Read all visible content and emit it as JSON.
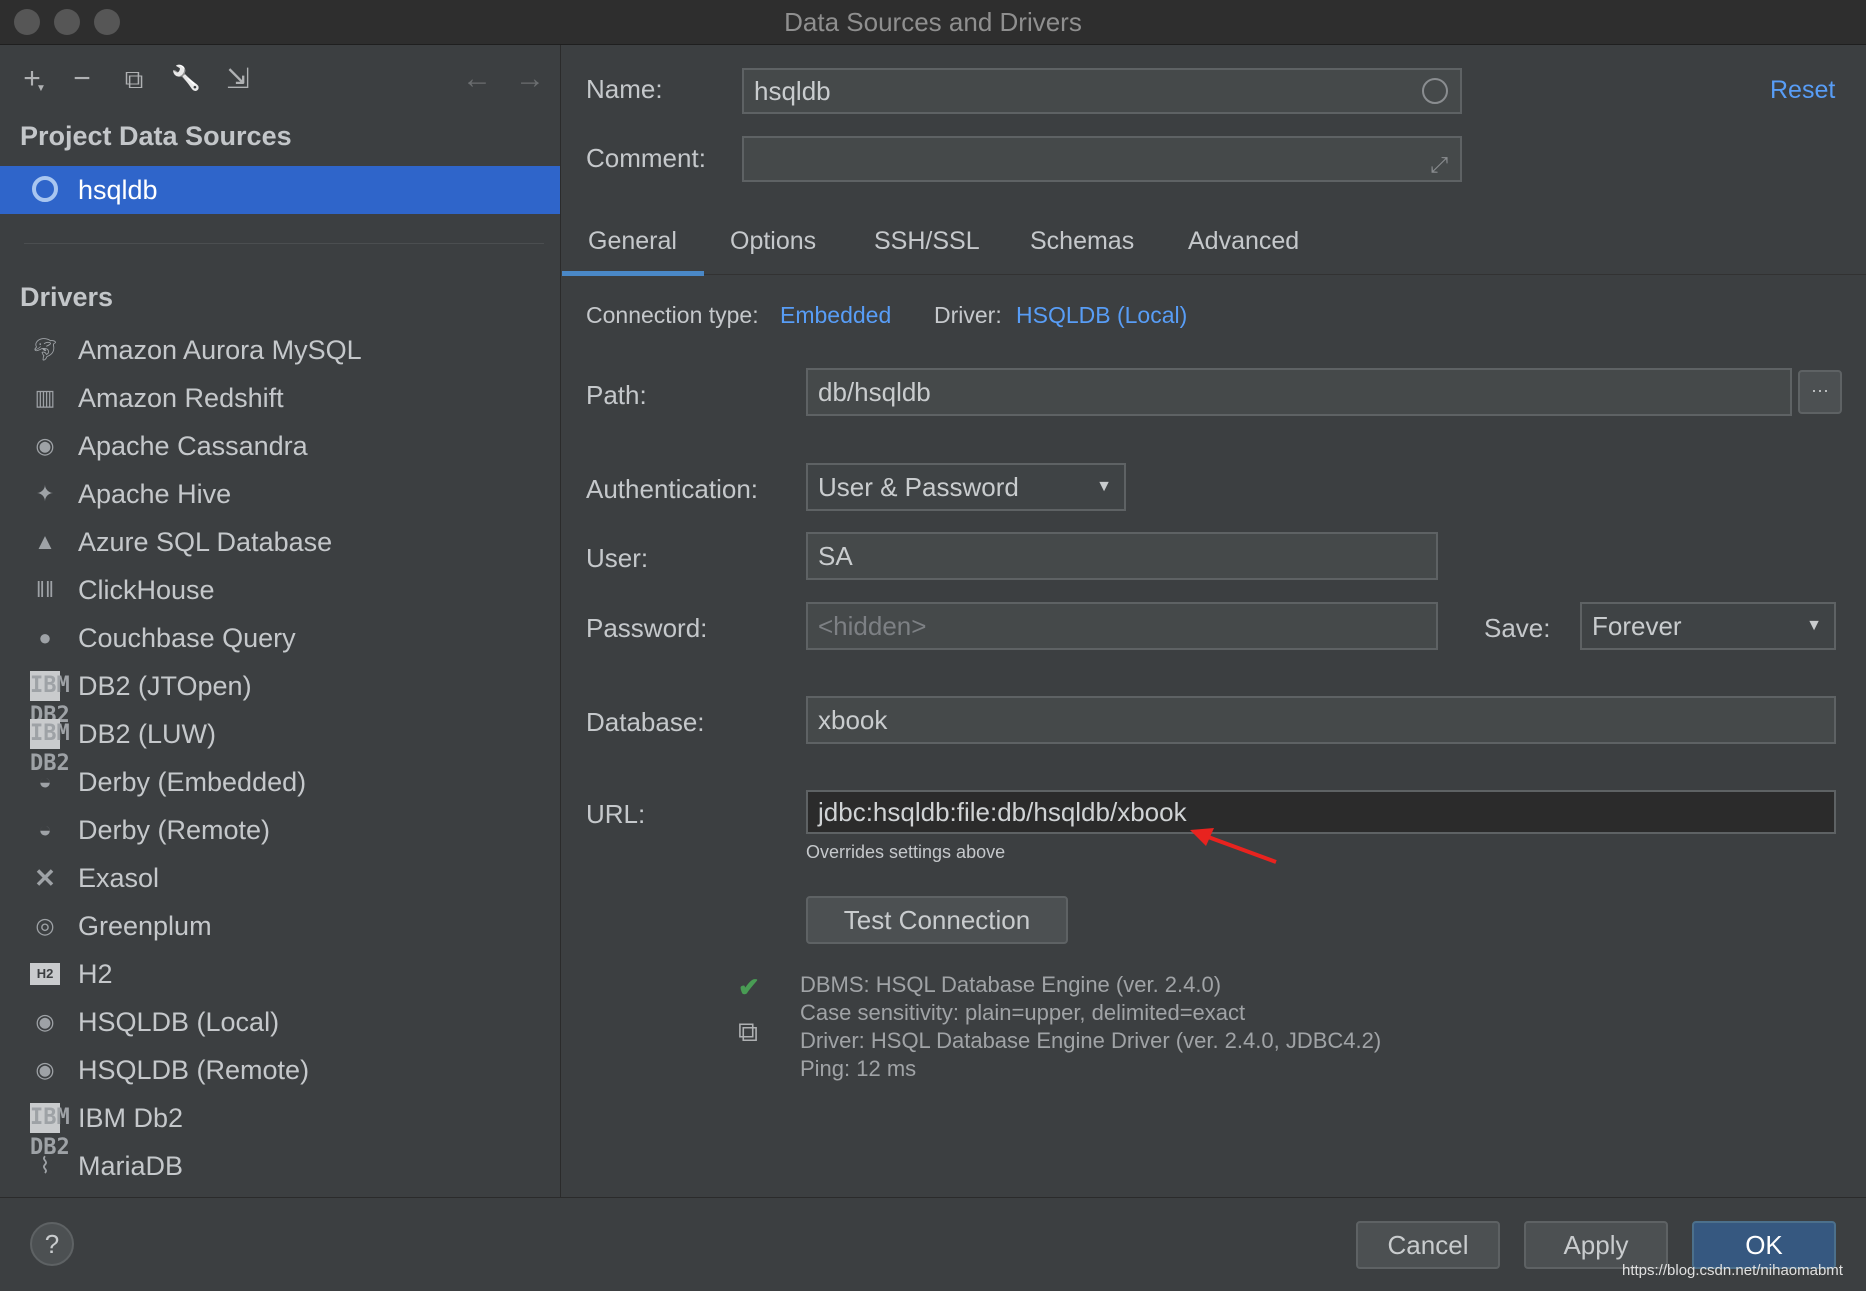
{
  "window": {
    "title": "Data Sources and Drivers"
  },
  "toolbar": {
    "add": "+",
    "remove": "−",
    "duplicate": "⧉",
    "wrench": "🔧",
    "import": "⇲",
    "back": "←",
    "forward": "→"
  },
  "sidebar": {
    "project_title": "Project Data Sources",
    "selected_source": "hsqldb",
    "drivers_title": "Drivers",
    "drivers": [
      {
        "label": "Amazon Aurora MySQL",
        "icon": "dolphin-icon"
      },
      {
        "label": "Amazon Redshift",
        "icon": "redshift-icon"
      },
      {
        "label": "Apache Cassandra",
        "icon": "eye-icon"
      },
      {
        "label": "Apache Hive",
        "icon": "hive-icon"
      },
      {
        "label": "Azure SQL Database",
        "icon": "azure-icon"
      },
      {
        "label": "ClickHouse",
        "icon": "clickhouse-icon"
      },
      {
        "label": "Couchbase Query",
        "icon": "couchbase-icon"
      },
      {
        "label": "DB2 (JTOpen)",
        "icon": "ibm-db2-icon"
      },
      {
        "label": "DB2 (LUW)",
        "icon": "ibm-db2-icon"
      },
      {
        "label": "Derby (Embedded)",
        "icon": "derby-hat-icon"
      },
      {
        "label": "Derby (Remote)",
        "icon": "derby-hat-icon"
      },
      {
        "label": "Exasol",
        "icon": "exasol-icon"
      },
      {
        "label": "Greenplum",
        "icon": "greenplum-icon"
      },
      {
        "label": "H2",
        "icon": "h2-icon"
      },
      {
        "label": "HSQLDB (Local)",
        "icon": "hsqldb-icon"
      },
      {
        "label": "HSQLDB (Remote)",
        "icon": "hsqldb-icon"
      },
      {
        "label": "IBM Db2",
        "icon": "ibm-db2-icon"
      },
      {
        "label": "MariaDB",
        "icon": "seal-icon"
      }
    ],
    "ibm_text": "IBM",
    "db2_text": "DB2",
    "h2_text": "H2"
  },
  "form": {
    "name_label": "Name:",
    "name_value": "hsqldb",
    "comment_label": "Comment:",
    "comment_value": "",
    "reset": "Reset",
    "tabs": [
      "General",
      "Options",
      "SSH/SSL",
      "Schemas",
      "Advanced"
    ],
    "active_tab": "General",
    "connection_type_label": "Connection type:",
    "connection_type_value": "Embedded",
    "driver_label": "Driver:",
    "driver_value": "HSQLDB (Local)",
    "path_label": "Path:",
    "path_value": "db/hsqldb",
    "browse": "···",
    "auth_label": "Authentication:",
    "auth_value": "User & Password",
    "user_label": "User:",
    "user_value": "SA",
    "password_label": "Password:",
    "password_placeholder": "<hidden>",
    "save_label": "Save:",
    "save_value": "Forever",
    "database_label": "Database:",
    "database_value": "xbook",
    "url_label": "URL:",
    "url_value": "jdbc:hsqldb:file:db/hsqldb/xbook",
    "url_hint": "Overrides settings above",
    "test_connection": "Test Connection",
    "result_lines": [
      "DBMS: HSQL Database Engine (ver. 2.4.0)",
      "Case sensitivity: plain=upper, delimited=exact",
      "Driver: HSQL Database Engine Driver (ver. 2.4.0, JDBC4.2)",
      "Ping: 12 ms"
    ]
  },
  "footer": {
    "help": "?",
    "cancel": "Cancel",
    "apply": "Apply",
    "ok": "OK",
    "watermark": "https://blog.csdn.net/nihaomabmt"
  },
  "colors": {
    "accent": "#2f65ca",
    "link": "#589df6",
    "success": "#499c54",
    "annotation_arrow": "#e8231f"
  }
}
